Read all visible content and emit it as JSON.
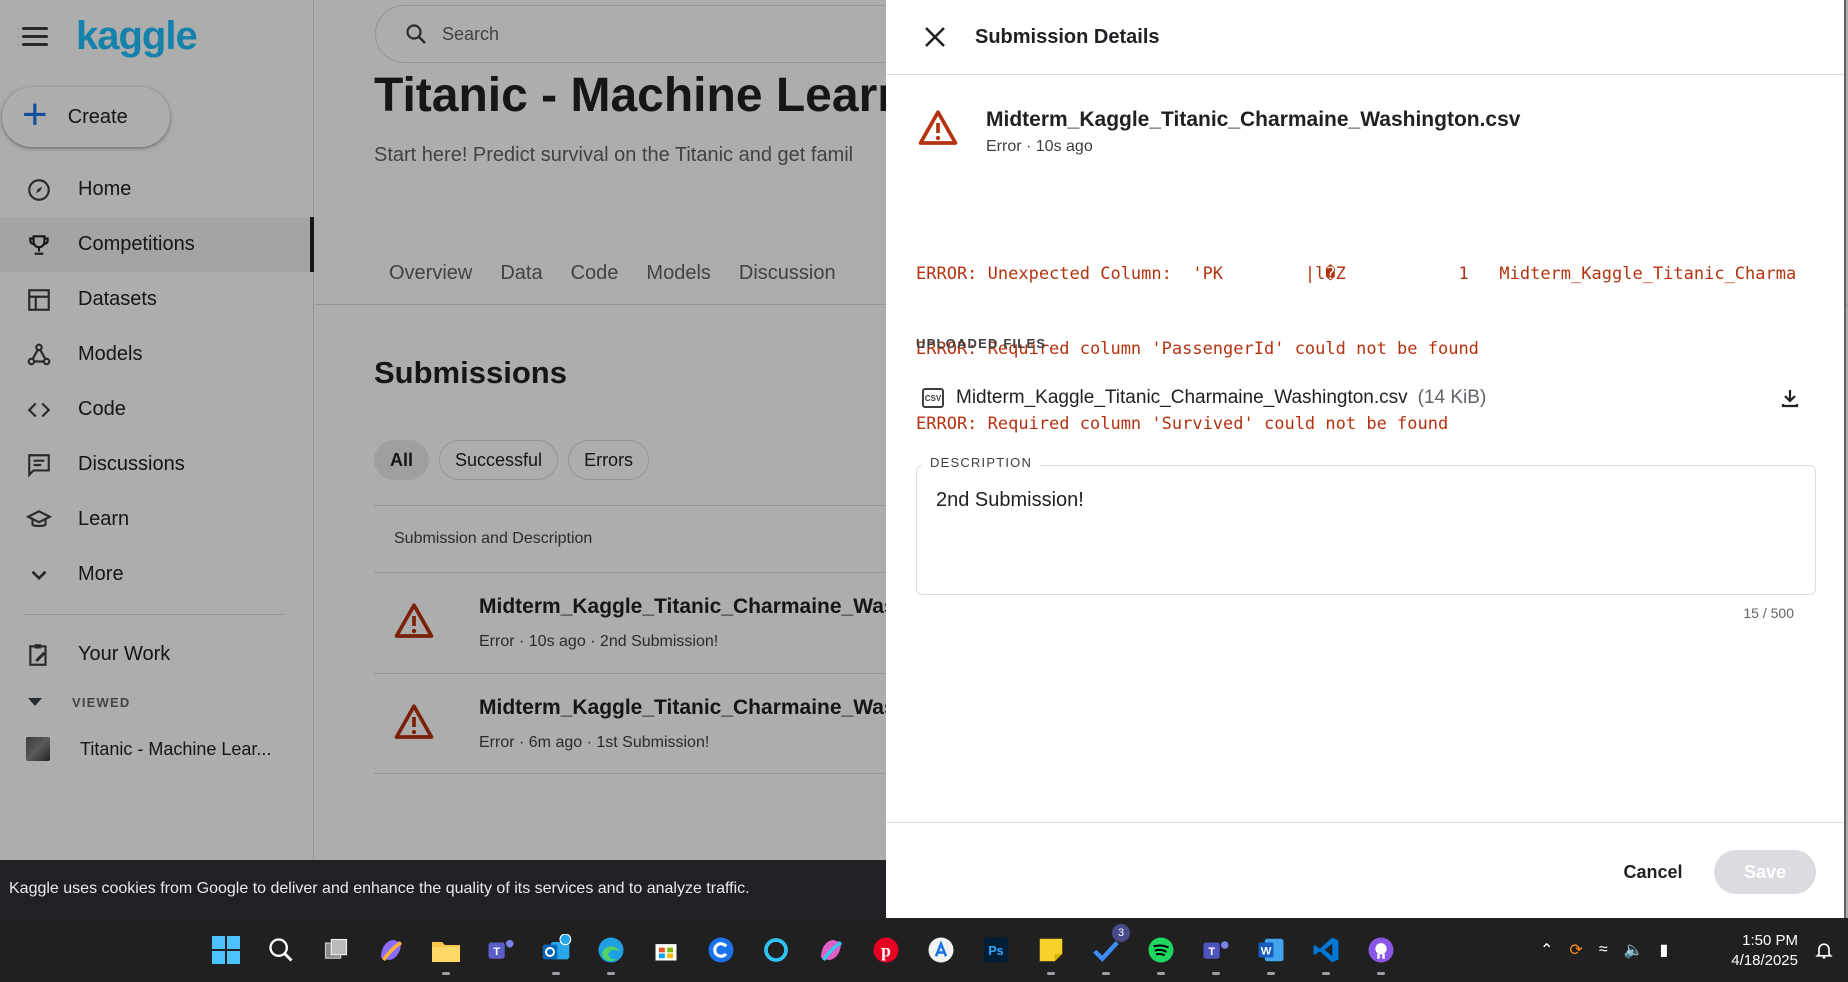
{
  "app": {
    "logo": "kaggle"
  },
  "sidebar": {
    "create_label": "Create",
    "items": [
      {
        "label": "Home",
        "icon": "compass-icon"
      },
      {
        "label": "Competitions",
        "icon": "trophy-icon",
        "active": true
      },
      {
        "label": "Datasets",
        "icon": "table-icon"
      },
      {
        "label": "Models",
        "icon": "models-icon"
      },
      {
        "label": "Code",
        "icon": "code-icon"
      },
      {
        "label": "Discussions",
        "icon": "comments-icon"
      },
      {
        "label": "Learn",
        "icon": "school-icon"
      },
      {
        "label": "More",
        "icon": "chevron-down-icon"
      }
    ],
    "your_work": "Your Work",
    "viewed_header": "VIEWED",
    "viewed_item": "Titanic - Machine Lear..."
  },
  "search": {
    "placeholder": "Search"
  },
  "competition": {
    "title": "Titanic - Machine Learn",
    "subtitle": "Start here! Predict survival on the Titanic and get famil",
    "tabs": [
      "Overview",
      "Data",
      "Code",
      "Models",
      "Discussion"
    ]
  },
  "submissions": {
    "title": "Submissions",
    "filters": [
      "All",
      "Successful",
      "Errors"
    ],
    "column_header": "Submission and Description",
    "rows": [
      {
        "name": "Midterm_Kaggle_Titanic_Charmaine_Washin",
        "meta": "Error · 10s ago · 2nd Submission!"
      },
      {
        "name": "Midterm_Kaggle_Titanic_Charmaine_Washin",
        "meta": "Error · 6m ago · 1st Submission!"
      }
    ]
  },
  "cookie_text": "Kaggle uses cookies from Google to deliver and enhance the quality of its services and to analyze traffic.",
  "panel": {
    "title": "Submission Details",
    "file_name": "Midterm_Kaggle_Titanic_Charmaine_Washington.csv",
    "file_meta": "Error · 10s ago",
    "errors": [
      "ERROR: Unexpected Column:  'PK        |l�Z           1   Midterm_Kaggle_Titanic_Charma",
      "ERROR: Required column 'PassengerId' could not be found",
      "ERROR: Required column 'Survived' could not be found"
    ],
    "uploaded_header": "UPLOADED FILES",
    "uploaded_file": {
      "name": "Midterm_Kaggle_Titanic_Charmaine_Washington.csv",
      "size": "(14 KiB)"
    },
    "description_label": "DESCRIPTION",
    "description_value": "2nd Submission!",
    "counter": "15 / 500",
    "cancel_label": "Cancel",
    "save_label": "Save"
  },
  "taskbar": {
    "apps": [
      "windows-start-icon",
      "search-icon",
      "task-view-icon",
      "copilot-icon",
      "file-explorer-icon",
      "teams-icon",
      "outlook-icon",
      "edge-icon",
      "store-icon",
      "browser-icon",
      "cortana-icon",
      "m365-icon",
      "pinterest-icon",
      "app-store-icon",
      "photoshop-icon",
      "sticky-notes-icon",
      "todo-icon",
      "spotify-icon",
      "teams-classic-icon",
      "word-icon",
      "vscode-icon",
      "github-icon"
    ],
    "todo_badge": "3",
    "time": "1:50 PM",
    "date": "4/18/2025"
  },
  "colors": {
    "brand": "#20beff",
    "error": "#b5320f",
    "warning_icon": "#b5320f"
  }
}
